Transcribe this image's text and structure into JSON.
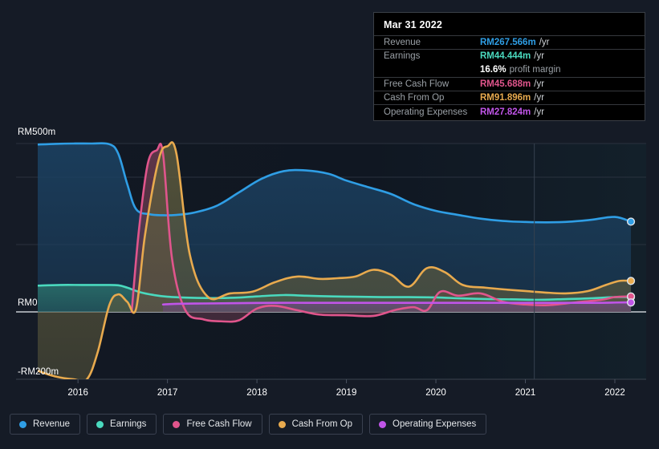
{
  "chart_data": {
    "type": "area",
    "title": "",
    "xlabel": "",
    "ylabel": "",
    "currency_prefix": "RM",
    "unit_suffix": "m",
    "x_ticks": [
      "2016",
      "2017",
      "2018",
      "2019",
      "2020",
      "2021",
      "2022"
    ],
    "y_ticks": [
      "RM500m",
      "RM0",
      "-RM200m"
    ],
    "ylim": [
      -200,
      500
    ],
    "xlim": [
      2015.55,
      2022.35
    ],
    "grid": true,
    "gridlines_y": [
      500,
      400,
      200,
      0
    ],
    "zero_line": 0,
    "legend_position": "bottom",
    "forecast_divider_x": 2021.1,
    "series": [
      {
        "name": "Revenue",
        "color": "#2f9ee5",
        "fill": "#1c4263",
        "x": [
          2015.55,
          2015.75,
          2015.95,
          2016.15,
          2016.35,
          2016.45,
          2016.55,
          2016.65,
          2016.8,
          2016.95,
          2017.1,
          2017.3,
          2017.55,
          2017.8,
          2018.05,
          2018.3,
          2018.55,
          2018.8,
          2019.0,
          2019.25,
          2019.5,
          2019.75,
          2020.0,
          2020.25,
          2020.5,
          2020.75,
          2021.0,
          2021.25,
          2021.5,
          2021.75,
          2022.0,
          2022.18
        ],
        "values": [
          497,
          499,
          500,
          500,
          498,
          470,
          380,
          305,
          290,
          287,
          288,
          295,
          315,
          355,
          395,
          418,
          420,
          410,
          390,
          370,
          350,
          320,
          300,
          288,
          277,
          270,
          267,
          266,
          268,
          274,
          282,
          268
        ]
      },
      {
        "name": "Earnings",
        "color": "#4ad9be",
        "fill": "#2a6f6a",
        "x": [
          2015.55,
          2015.8,
          2016.05,
          2016.3,
          2016.45,
          2016.55,
          2016.7,
          2016.85,
          2017.0,
          2017.25,
          2017.5,
          2017.75,
          2018.0,
          2018.3,
          2018.55,
          2018.85,
          2019.1,
          2019.4,
          2019.7,
          2020.0,
          2020.3,
          2020.6,
          2020.9,
          2021.15,
          2021.45,
          2021.7,
          2022.0,
          2022.18
        ],
        "values": [
          78,
          80,
          80,
          80,
          79,
          72,
          58,
          50,
          45,
          42,
          41,
          42,
          46,
          50,
          48,
          46,
          45,
          44,
          44,
          43,
          40,
          38,
          37,
          36,
          38,
          40,
          44,
          44
        ]
      },
      {
        "name": "Free Cash Flow",
        "color": "#e0558c",
        "fill": "#6a3a4e",
        "x": [
          2016.6,
          2016.68,
          2016.78,
          2016.88,
          2016.95,
          2017.05,
          2017.2,
          2017.4,
          2017.6,
          2017.8,
          2018.0,
          2018.2,
          2018.45,
          2018.7,
          2019.0,
          2019.3,
          2019.55,
          2019.75,
          2019.9,
          2020.05,
          2020.25,
          2020.5,
          2020.75,
          2021.0,
          2021.25,
          2021.55,
          2021.85,
          2022.0,
          2022.18
        ],
        "values": [
          0,
          240,
          440,
          480,
          470,
          160,
          5,
          -22,
          -28,
          -25,
          10,
          18,
          5,
          -8,
          -10,
          -12,
          6,
          14,
          5,
          60,
          48,
          55,
          30,
          22,
          20,
          28,
          36,
          44,
          46
        ]
      },
      {
        "name": "Cash From Op",
        "color": "#e8aa4e",
        "fill": "#5c5a3e",
        "x": [
          2015.55,
          2015.75,
          2015.95,
          2016.1,
          2016.22,
          2016.35,
          2016.45,
          2016.55,
          2016.65,
          2016.75,
          2016.9,
          2017.0,
          2017.1,
          2017.25,
          2017.45,
          2017.7,
          2017.95,
          2018.2,
          2018.45,
          2018.7,
          2018.9,
          2019.1,
          2019.3,
          2019.5,
          2019.7,
          2019.9,
          2020.1,
          2020.3,
          2020.55,
          2020.8,
          2021.0,
          2021.2,
          2021.45,
          2021.7,
          2021.9,
          2022.05,
          2022.18
        ],
        "values": [
          -175,
          -192,
          -200,
          -200,
          -120,
          20,
          52,
          30,
          10,
          230,
          450,
          492,
          470,
          170,
          45,
          55,
          60,
          88,
          105,
          98,
          100,
          105,
          125,
          110,
          75,
          130,
          118,
          80,
          72,
          66,
          62,
          58,
          55,
          62,
          80,
          92,
          92
        ]
      },
      {
        "name": "Operating Expenses",
        "color": "#c055e8",
        "fill": "#6a4a7a",
        "x": [
          2016.95,
          2017.1,
          2017.4,
          2017.8,
          2018.2,
          2018.6,
          2019.0,
          2019.4,
          2019.8,
          2020.2,
          2020.6,
          2021.0,
          2021.4,
          2021.8,
          2022.05,
          2022.18
        ],
        "values": [
          22,
          24,
          25,
          26,
          27,
          27,
          27,
          27,
          27,
          27,
          27,
          27,
          27,
          27,
          28,
          28
        ]
      }
    ]
  },
  "tooltip": {
    "date": "Mar 31 2022",
    "rows": [
      {
        "label": "Revenue",
        "value": "RM267.566m",
        "unit": "/yr",
        "color": "#2f9ee5"
      },
      {
        "label": "Earnings",
        "value": "RM44.444m",
        "unit": "/yr",
        "color": "#4ad9be"
      },
      {
        "label": "",
        "value": "16.6%",
        "unit": "profit margin",
        "color": "#ffffff",
        "unit_style": "note",
        "no_border": true
      },
      {
        "label": "Free Cash Flow",
        "value": "RM45.688m",
        "unit": "/yr",
        "color": "#e0558c"
      },
      {
        "label": "Cash From Op",
        "value": "RM91.896m",
        "unit": "/yr",
        "color": "#e8aa4e"
      },
      {
        "label": "Operating Expenses",
        "value": "RM27.824m",
        "unit": "/yr",
        "color": "#c055e8"
      }
    ]
  },
  "legend": {
    "items": [
      {
        "label": "Revenue",
        "color": "#2f9ee5"
      },
      {
        "label": "Earnings",
        "color": "#4ad9be"
      },
      {
        "label": "Free Cash Flow",
        "color": "#e0558c"
      },
      {
        "label": "Cash From Op",
        "color": "#e8aa4e"
      },
      {
        "label": "Operating Expenses",
        "color": "#c055e8"
      }
    ]
  },
  "axis": {
    "y_top": "RM500m",
    "y_zero": "RM0",
    "y_bottom": "-RM200m"
  }
}
